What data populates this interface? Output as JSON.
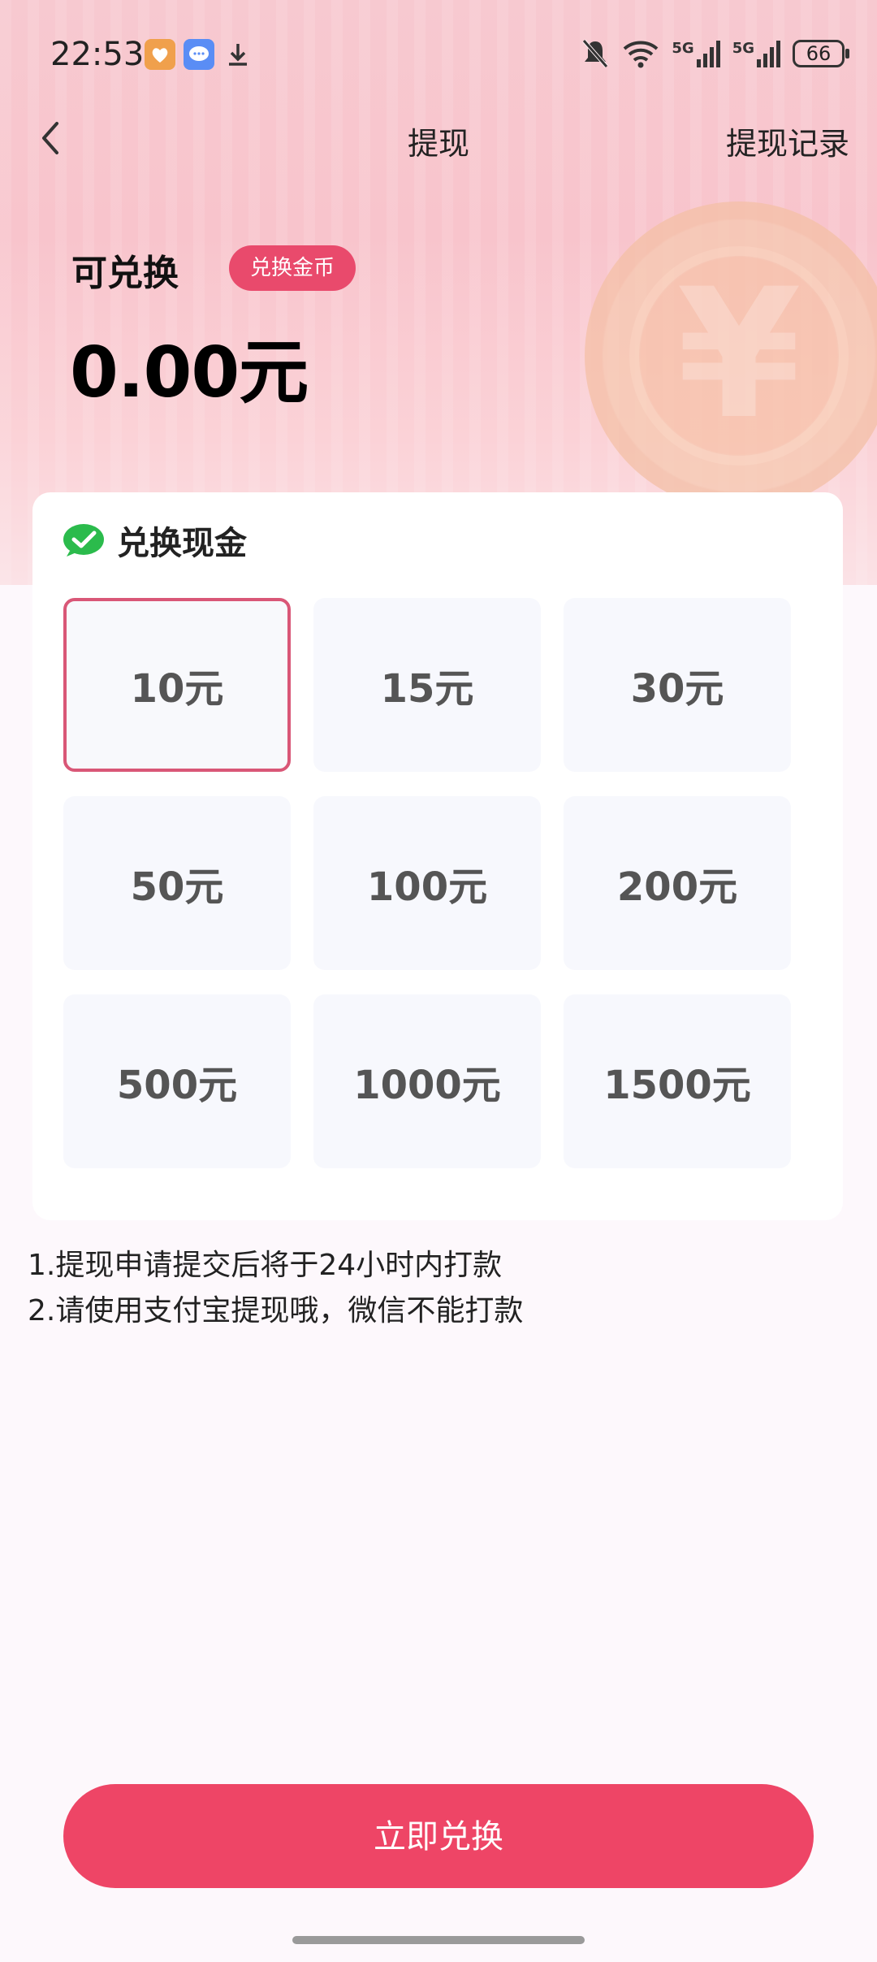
{
  "status_bar": {
    "time": "22:53",
    "battery": "66",
    "network_label": "5G"
  },
  "nav": {
    "title": "提现",
    "right_link": "提现记录"
  },
  "balance": {
    "label": "可兑换",
    "badge": "兑换金币",
    "value": "0.00元"
  },
  "card": {
    "title": "兑换现金",
    "options": [
      {
        "label": "10元",
        "selected": true
      },
      {
        "label": "15元",
        "selected": false
      },
      {
        "label": "30元",
        "selected": false
      },
      {
        "label": "50元",
        "selected": false
      },
      {
        "label": "100元",
        "selected": false
      },
      {
        "label": "200元",
        "selected": false
      },
      {
        "label": "500元",
        "selected": false
      },
      {
        "label": "1000元",
        "selected": false
      },
      {
        "label": "1500元",
        "selected": false
      }
    ]
  },
  "notes": [
    "1.提现申请提交后将于24小时内打款",
    "2.请使用支付宝提现哦，微信不能打款"
  ],
  "cta": {
    "label": "立即兑换"
  },
  "colors": {
    "accent": "#ee4566",
    "badge": "#e94a6c",
    "selected_border": "#d95777",
    "check_green": "#2bbb4c"
  },
  "icons": {
    "back": "chevron-left-icon",
    "check": "check-bubble-icon",
    "coin": "yen-coin-icon"
  },
  "coin_symbol": "¥"
}
